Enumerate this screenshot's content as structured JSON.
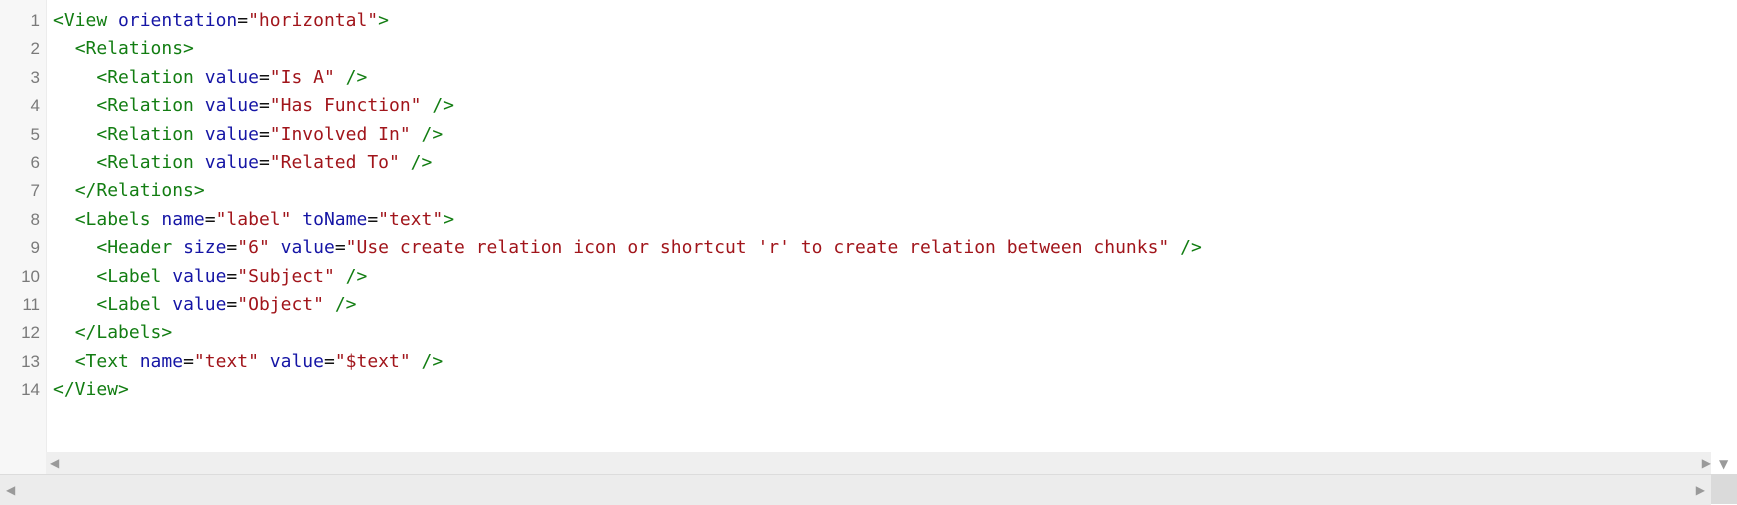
{
  "editor": {
    "lines": [
      {
        "no": "1",
        "tokens": [
          {
            "t": "tag",
            "v": "<View"
          },
          {
            "t": "punct",
            "v": " "
          },
          {
            "t": "attr",
            "v": "orientation"
          },
          {
            "t": "punct",
            "v": "="
          },
          {
            "t": "str",
            "v": "\"horizontal\""
          },
          {
            "t": "tag",
            "v": ">"
          }
        ]
      },
      {
        "no": "2",
        "tokens": [
          {
            "t": "punct",
            "v": "  "
          },
          {
            "t": "tag",
            "v": "<Relations>"
          }
        ]
      },
      {
        "no": "3",
        "tokens": [
          {
            "t": "punct",
            "v": "    "
          },
          {
            "t": "tag",
            "v": "<Relation"
          },
          {
            "t": "punct",
            "v": " "
          },
          {
            "t": "attr",
            "v": "value"
          },
          {
            "t": "punct",
            "v": "="
          },
          {
            "t": "str",
            "v": "\"Is A\""
          },
          {
            "t": "punct",
            "v": " "
          },
          {
            "t": "tag",
            "v": "/>"
          }
        ]
      },
      {
        "no": "4",
        "tokens": [
          {
            "t": "punct",
            "v": "    "
          },
          {
            "t": "tag",
            "v": "<Relation"
          },
          {
            "t": "punct",
            "v": " "
          },
          {
            "t": "attr",
            "v": "value"
          },
          {
            "t": "punct",
            "v": "="
          },
          {
            "t": "str",
            "v": "\"Has Function\""
          },
          {
            "t": "punct",
            "v": " "
          },
          {
            "t": "tag",
            "v": "/>"
          }
        ]
      },
      {
        "no": "5",
        "tokens": [
          {
            "t": "punct",
            "v": "    "
          },
          {
            "t": "tag",
            "v": "<Relation"
          },
          {
            "t": "punct",
            "v": " "
          },
          {
            "t": "attr",
            "v": "value"
          },
          {
            "t": "punct",
            "v": "="
          },
          {
            "t": "str",
            "v": "\"Involved In\""
          },
          {
            "t": "punct",
            "v": " "
          },
          {
            "t": "tag",
            "v": "/>"
          }
        ]
      },
      {
        "no": "6",
        "tokens": [
          {
            "t": "punct",
            "v": "    "
          },
          {
            "t": "tag",
            "v": "<Relation"
          },
          {
            "t": "punct",
            "v": " "
          },
          {
            "t": "attr",
            "v": "value"
          },
          {
            "t": "punct",
            "v": "="
          },
          {
            "t": "str",
            "v": "\"Related To\""
          },
          {
            "t": "punct",
            "v": " "
          },
          {
            "t": "tag",
            "v": "/>"
          }
        ]
      },
      {
        "no": "7",
        "tokens": [
          {
            "t": "punct",
            "v": "  "
          },
          {
            "t": "tag",
            "v": "</Relations>"
          }
        ]
      },
      {
        "no": "8",
        "tokens": [
          {
            "t": "punct",
            "v": "  "
          },
          {
            "t": "tag",
            "v": "<Labels"
          },
          {
            "t": "punct",
            "v": " "
          },
          {
            "t": "attr",
            "v": "name"
          },
          {
            "t": "punct",
            "v": "="
          },
          {
            "t": "str",
            "v": "\"label\""
          },
          {
            "t": "punct",
            "v": " "
          },
          {
            "t": "attr",
            "v": "toName"
          },
          {
            "t": "punct",
            "v": "="
          },
          {
            "t": "str",
            "v": "\"text\""
          },
          {
            "t": "tag",
            "v": ">"
          }
        ]
      },
      {
        "no": "9",
        "tokens": [
          {
            "t": "punct",
            "v": "    "
          },
          {
            "t": "tag",
            "v": "<Header"
          },
          {
            "t": "punct",
            "v": " "
          },
          {
            "t": "attr",
            "v": "size"
          },
          {
            "t": "punct",
            "v": "="
          },
          {
            "t": "str",
            "v": "\"6\""
          },
          {
            "t": "punct",
            "v": " "
          },
          {
            "t": "attr",
            "v": "value"
          },
          {
            "t": "punct",
            "v": "="
          },
          {
            "t": "str",
            "v": "\"Use create relation icon or shortcut 'r' to create relation between chunks\""
          },
          {
            "t": "punct",
            "v": " "
          },
          {
            "t": "tag",
            "v": "/>"
          }
        ]
      },
      {
        "no": "10",
        "tokens": [
          {
            "t": "punct",
            "v": "    "
          },
          {
            "t": "tag",
            "v": "<Label"
          },
          {
            "t": "punct",
            "v": " "
          },
          {
            "t": "attr",
            "v": "value"
          },
          {
            "t": "punct",
            "v": "="
          },
          {
            "t": "str",
            "v": "\"Subject\""
          },
          {
            "t": "punct",
            "v": " "
          },
          {
            "t": "tag",
            "v": "/>"
          }
        ]
      },
      {
        "no": "11",
        "tokens": [
          {
            "t": "punct",
            "v": "    "
          },
          {
            "t": "tag",
            "v": "<Label"
          },
          {
            "t": "punct",
            "v": " "
          },
          {
            "t": "attr",
            "v": "value"
          },
          {
            "t": "punct",
            "v": "="
          },
          {
            "t": "str",
            "v": "\"Object\""
          },
          {
            "t": "punct",
            "v": " "
          },
          {
            "t": "tag",
            "v": "/>"
          }
        ]
      },
      {
        "no": "12",
        "tokens": [
          {
            "t": "punct",
            "v": "  "
          },
          {
            "t": "tag",
            "v": "</Labels>"
          }
        ]
      },
      {
        "no": "13",
        "tokens": [
          {
            "t": "punct",
            "v": "  "
          },
          {
            "t": "tag",
            "v": "<Text"
          },
          {
            "t": "punct",
            "v": " "
          },
          {
            "t": "attr",
            "v": "name"
          },
          {
            "t": "punct",
            "v": "="
          },
          {
            "t": "str",
            "v": "\"text\""
          },
          {
            "t": "punct",
            "v": " "
          },
          {
            "t": "attr",
            "v": "value"
          },
          {
            "t": "punct",
            "v": "="
          },
          {
            "t": "str",
            "v": "\"$text\""
          },
          {
            "t": "punct",
            "v": " "
          },
          {
            "t": "tag",
            "v": "/>"
          }
        ]
      },
      {
        "no": "14",
        "tokens": [
          {
            "t": "tag",
            "v": "</View>"
          }
        ]
      }
    ]
  },
  "colors": {
    "tag": "#127d12",
    "attr": "#1515a5",
    "string": "#a1151b",
    "line_number": "#7a7a7a",
    "gutter_bg": "#f7f7f7",
    "scrollbar_bg": "#efefef"
  },
  "scrollbars": {
    "inner_left_icon": "arrow-left-icon",
    "inner_right_icon": "arrow-right-icon",
    "vertical_down_icon": "arrow-down-icon",
    "outer_left_icon": "arrow-left-icon",
    "outer_right_icon": "arrow-right-icon"
  }
}
